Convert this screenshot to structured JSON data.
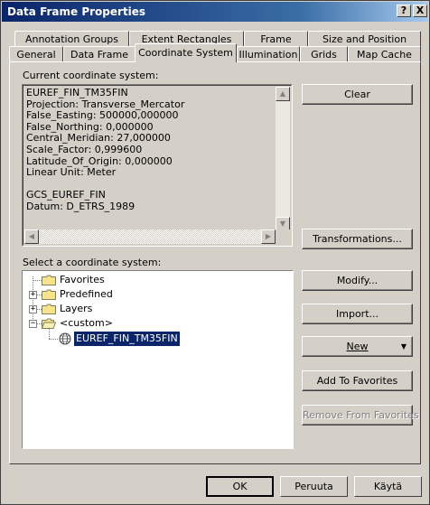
{
  "window": {
    "title": "Data Frame Properties"
  },
  "titlebar_buttons": {
    "help": "?",
    "close": "X"
  },
  "tabs_row1": [
    "Annotation Groups",
    "Extent Rectangles",
    "Frame",
    "Size and Position"
  ],
  "tabs_row2": [
    "General",
    "Data Frame",
    "Coordinate System",
    "Illumination",
    "Grids",
    "Map Cache"
  ],
  "active_tab": "Coordinate System",
  "current_cs": {
    "label": "Current coordinate system:",
    "text": "EUREF_FIN_TM35FIN\nProjection: Transverse_Mercator\nFalse_Easting: 500000,000000\nFalse_Northing: 0,000000\nCentral_Meridian: 27,000000\nScale_Factor: 0,999600\nLatitude_Of_Origin: 0,000000\nLinear Unit: Meter\n\nGCS_EUREF_FIN\nDatum: D_ETRS_1989"
  },
  "select_cs": {
    "label": "Select a coordinate system:",
    "tree": [
      {
        "label": "Favorites",
        "expander": ""
      },
      {
        "label": "Predefined",
        "expander": "+"
      },
      {
        "label": "Layers",
        "expander": "+"
      },
      {
        "label": "<custom>",
        "expander": "−"
      },
      {
        "label": "EUREF_FIN_TM35FIN",
        "expander": "",
        "selected": true
      }
    ]
  },
  "buttons": {
    "clear": "Clear",
    "transformations": "Transformations...",
    "modify": "Modify...",
    "import": "Import...",
    "new": "New",
    "add_to_favorites": "Add To Favorites",
    "remove_from_favorites": "Remove From Favorites"
  },
  "footer": {
    "ok": "OK",
    "cancel": "Peruuta",
    "apply": "Käytä"
  },
  "colors": {
    "title_start": "#0a246a",
    "title_end": "#a6caf0",
    "selection": "#0a246a",
    "face": "#d4d0c8"
  }
}
